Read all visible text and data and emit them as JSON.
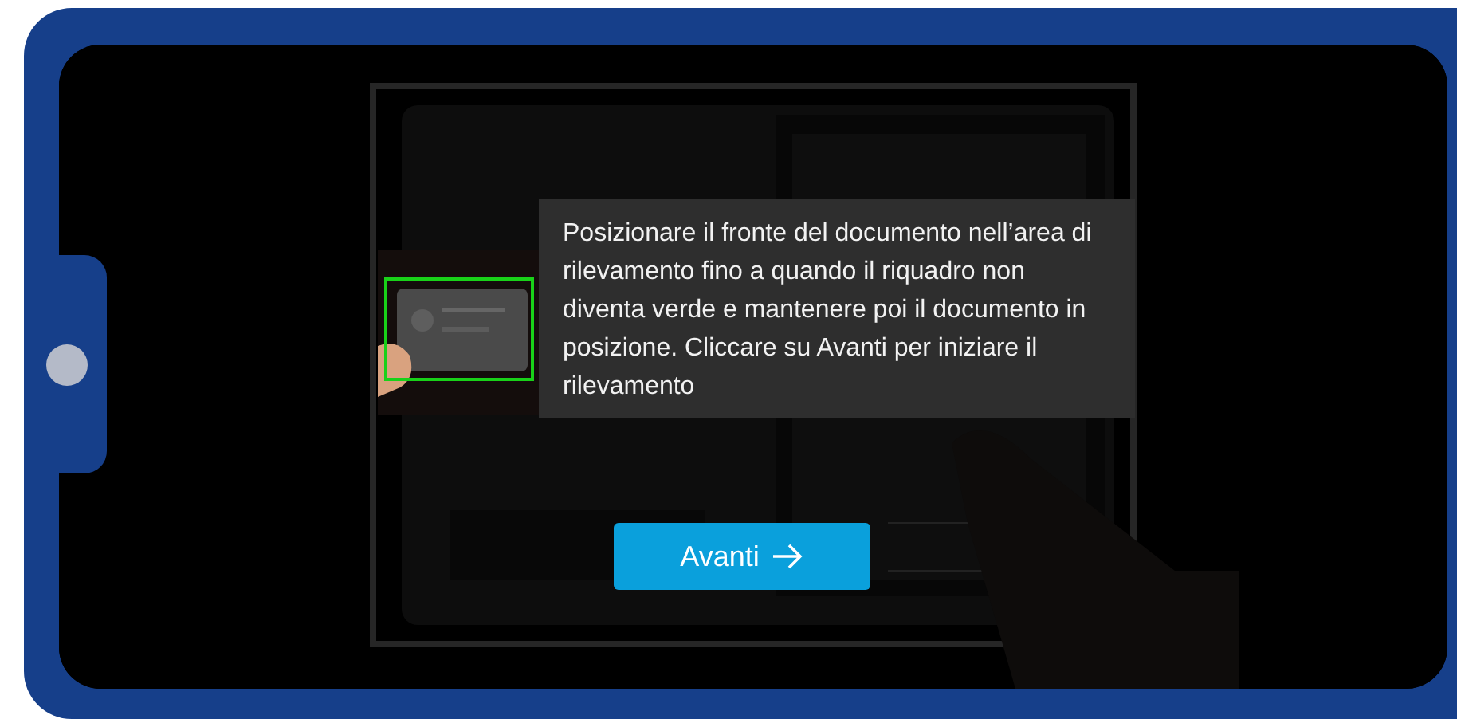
{
  "instruction": {
    "text": "Posizionare il fronte del documento nell’area di rilevamento fino a quando il riquadro non diventa verde e mantenere poi il documento in posizione. Cliccare su Avanti per iniziare il rilevamento"
  },
  "button": {
    "label": "Avanti"
  }
}
